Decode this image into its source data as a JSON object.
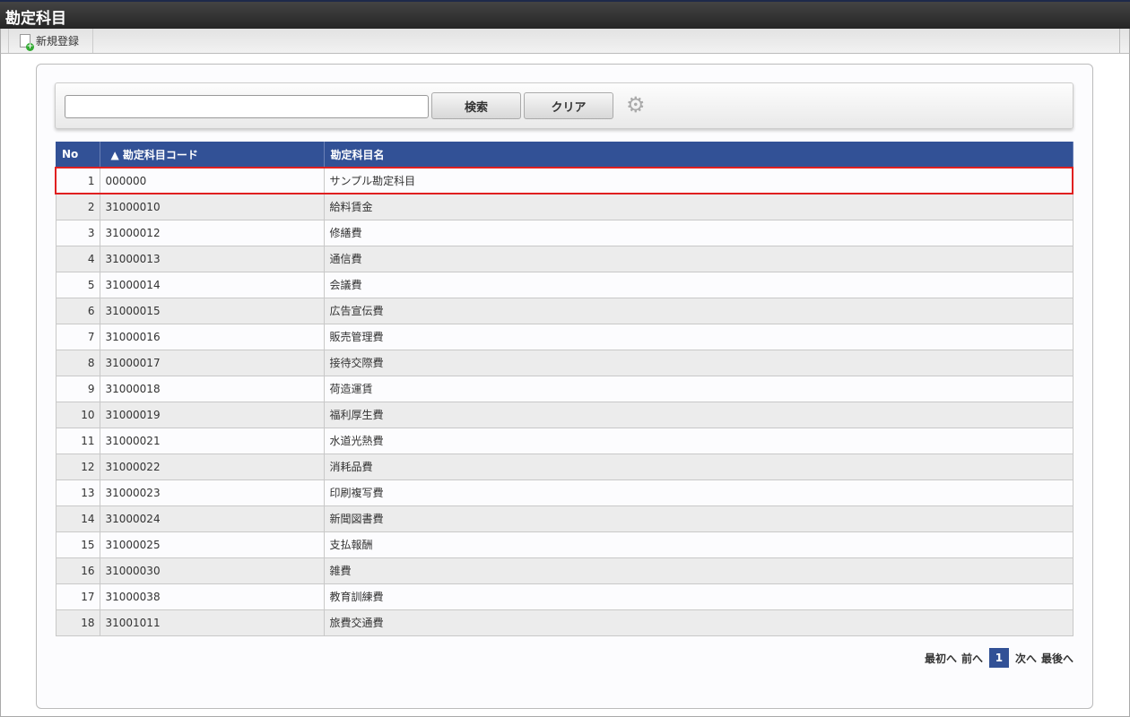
{
  "title": "勘定科目",
  "toolbar": {
    "new_label": "新規登録"
  },
  "search": {
    "value": "",
    "placeholder": "",
    "search_label": "検索",
    "clear_label": "クリア"
  },
  "table": {
    "headers": [
      "No",
      "▲ 勘定科目コード",
      "勘定科目名"
    ],
    "rows": [
      [
        "1",
        "000000",
        "サンプル勘定科目"
      ],
      [
        "2",
        "31000010",
        "給料賃金"
      ],
      [
        "3",
        "31000012",
        "修繕費"
      ],
      [
        "4",
        "31000013",
        "通信費"
      ],
      [
        "5",
        "31000014",
        "会議費"
      ],
      [
        "6",
        "31000015",
        "広告宣伝費"
      ],
      [
        "7",
        "31000016",
        "販売管理費"
      ],
      [
        "8",
        "31000017",
        "接待交際費"
      ],
      [
        "9",
        "31000018",
        "荷造運賃"
      ],
      [
        "10",
        "31000019",
        "福利厚生費"
      ],
      [
        "11",
        "31000021",
        "水道光熱費"
      ],
      [
        "12",
        "31000022",
        "消耗品費"
      ],
      [
        "13",
        "31000023",
        "印刷複写費"
      ],
      [
        "14",
        "31000024",
        "新聞図書費"
      ],
      [
        "15",
        "31000025",
        "支払報酬"
      ],
      [
        "16",
        "31000030",
        "雑費"
      ],
      [
        "17",
        "31000038",
        "教育訓練費"
      ],
      [
        "18",
        "31001011",
        "旅費交通費"
      ]
    ]
  },
  "pager": {
    "first": "最初へ",
    "prev": "前へ",
    "current": "1",
    "next": "次へ",
    "last": "最後へ"
  }
}
